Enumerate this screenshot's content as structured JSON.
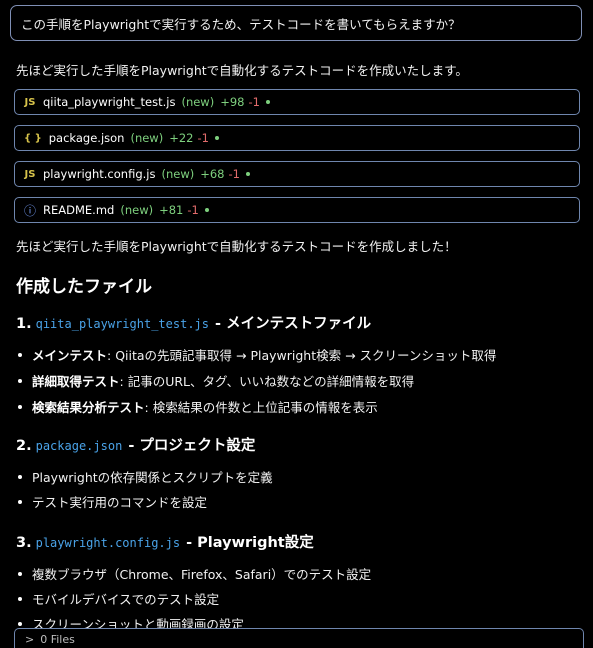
{
  "prompt": "この手順をPlaywrightで実行するため、テストコードを書いてもらえますか？",
  "intro": "先ほど実行した手順をPlaywrightで自動化するテストコードを作成いたします。",
  "files": [
    {
      "icon": "JS",
      "name": "qiita_playwright_test.js",
      "new": "(new)",
      "add": "+98",
      "del": "-1"
    },
    {
      "icon": "{ }",
      "name": "package.json",
      "new": "(new)",
      "add": "+22",
      "del": "-1"
    },
    {
      "icon": "JS",
      "name": "playwright.config.js",
      "new": "(new)",
      "add": "+68",
      "del": "-1"
    },
    {
      "icon": "ⓘ",
      "name": "README.md",
      "new": "(new)",
      "add": "+81",
      "del": "-1"
    }
  ],
  "summary": "先ほど実行した手順をPlaywrightで自動化するテストコードを作成しました！",
  "heading": "作成したファイル",
  "sections": [
    {
      "num": "1.",
      "code": "qiita_playwright_test.js",
      "title": "- メインテストファイル",
      "bullets": [
        {
          "bold": "メインテスト",
          "text": ": Qiitaの先頭記事取得 → Playwright検索 → スクリーンショット取得"
        },
        {
          "bold": "詳細取得テスト",
          "text": ": 記事のURL、タグ、いいね数などの詳細情報を取得"
        },
        {
          "bold": "検索結果分析テスト",
          "text": ": 検索結果の件数と上位記事の情報を表示"
        }
      ]
    },
    {
      "num": "2.",
      "code": "package.json",
      "title": "- プロジェクト設定",
      "bullets": [
        {
          "bold": "",
          "text": "Playwrightの依存関係とスクリプトを定義"
        },
        {
          "bold": "",
          "text": "テスト実行用のコマンドを設定"
        }
      ]
    },
    {
      "num": "3.",
      "code": "playwright.config.js",
      "title": "- Playwright設定",
      "bullets": [
        {
          "bold": "",
          "text": "複数ブラウザ（Chrome、Firefox、Safari）でのテスト設定"
        },
        {
          "bold": "",
          "text": "モバイルデバイスでのテスト設定"
        },
        {
          "bold": "",
          "text": "スクリーンショットと動画録画の設定"
        }
      ]
    }
  ],
  "footer": {
    "chevron": ">",
    "label": "0 Files"
  },
  "colors": {
    "code": "#4aa3e8",
    "added": "#7ed07e",
    "removed": "#e26b6b",
    "border": "#6f86ae"
  }
}
